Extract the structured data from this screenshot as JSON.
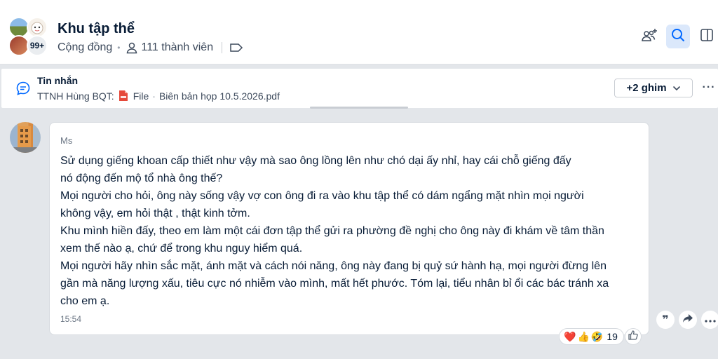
{
  "header": {
    "title": "Khu tập thể",
    "type_label": "Cộng đồng",
    "member_count": "111 thành viên",
    "member_badge": "99+"
  },
  "pinned": {
    "heading": "Tin nhắn",
    "sender": "TTNH Hùng BQT:",
    "file_label": "File",
    "separator": "·",
    "file_name": "Biên bản họp 10.5.2026.pdf",
    "more_pins": "+2 ghim",
    "more_menu": "···"
  },
  "message": {
    "sender": "Ms",
    "lines": [
      "Sử dụng giếng khoan cấp thiết như vậy mà sao ông          lồng lên như chó dại ấy nhỉ, hay cái chỗ giếng đấy",
      "nó động đến mộ tổ nhà ông thế?",
      "Mọi người cho hỏi, ông này sống vậy vợ con ông đi ra vào khu tập thể có dám ngẩng mặt nhìn mọi người",
      "không vậy, em hỏi thật , thật kinh tởm.",
      "Khu mình hiền đấy, theo em làm một cái đơn tập thể gửi ra phường đề nghị cho ông này đi khám về tâm thần",
      "xem thế nào ạ, chứ để trong khu nguy hiểm quá.",
      "Mọi người hãy nhìn sắc mặt, ánh mặt và cách nói năng, ông này đang bị quỷ sứ hành hạ, mọi người đừng lên",
      "gần mà năng lượng xấu, tiêu cực nó nhiễm vào mình, mất hết phước. Tóm lại, tiểu nhân bỉ ổi các bác tránh xa",
      "cho em ạ."
    ],
    "time": "15:54",
    "reactions": {
      "emojis": [
        "❤️",
        "👍",
        "🤣"
      ],
      "count": "19"
    }
  },
  "actions": {
    "quote_glyph": "❞"
  },
  "colors": {
    "accent": "#0068ff",
    "search_bg": "#dbe8fb",
    "page_bg": "#e3e6ea",
    "pdf_red": "#e5493a"
  },
  "icons": [
    "add-member-icon",
    "search-icon",
    "side-panel-icon",
    "chat-bubble-icon",
    "pdf-file-icon",
    "user-icon",
    "tag-icon",
    "chevron-down-icon",
    "share-icon",
    "thumbs-up-icon"
  ]
}
